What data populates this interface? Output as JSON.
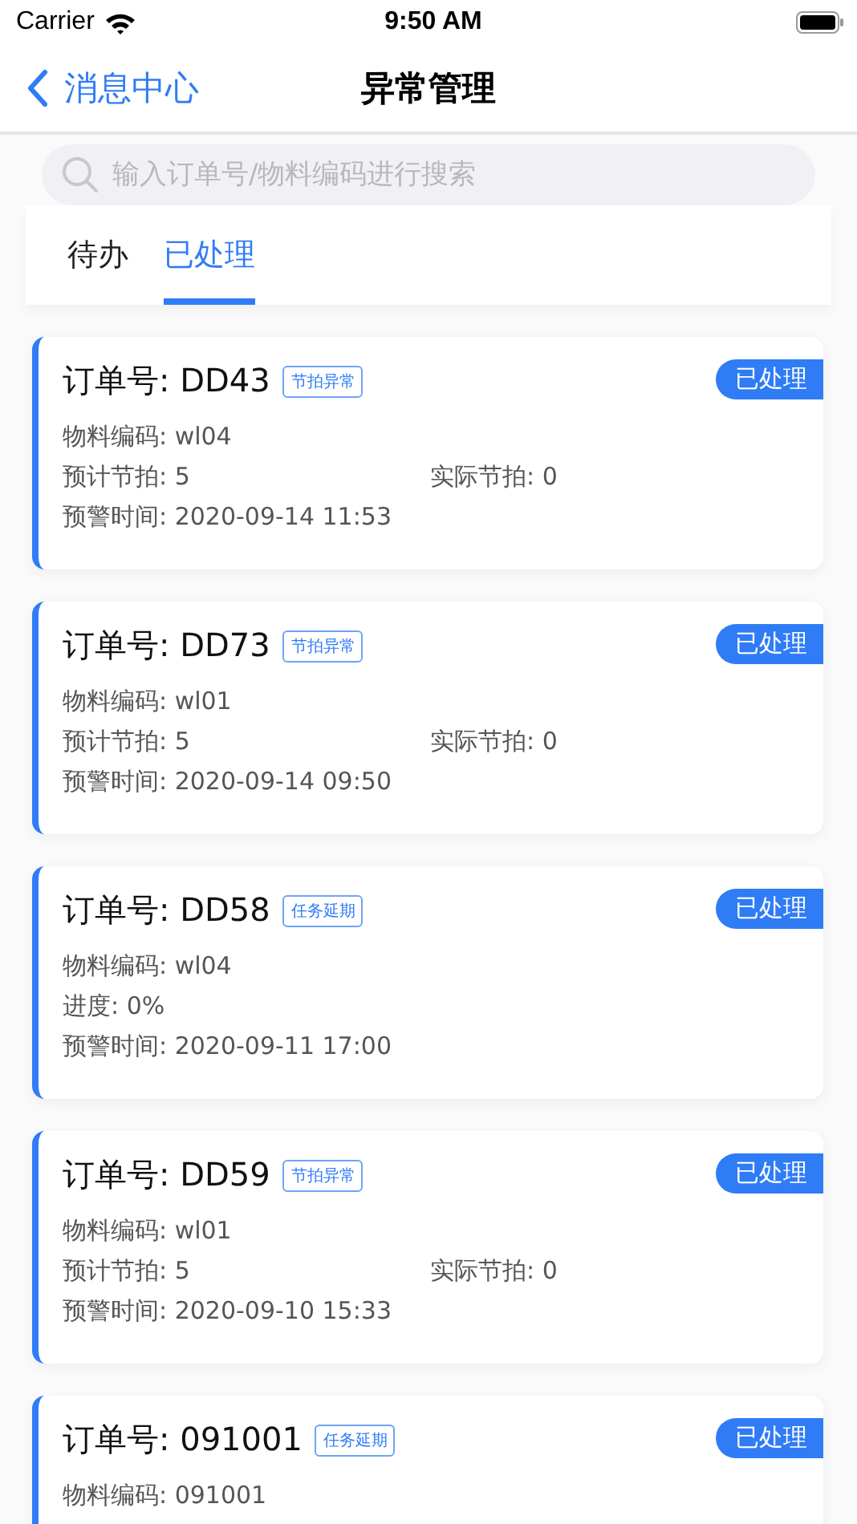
{
  "status_bar": {
    "carrier": "Carrier",
    "time": "9:50 AM"
  },
  "nav": {
    "back": "消息中心",
    "title": "异常管理"
  },
  "search": {
    "placeholder": "输入订单号/物料编码进行搜索"
  },
  "tabs": [
    {
      "label": "待办",
      "selected": false
    },
    {
      "label": "已处理",
      "selected": true
    }
  ],
  "cards": [
    {
      "order": "订单号: DD43",
      "tag": "节拍异常",
      "status": "已处理",
      "lines": [
        [
          "物料编码: wl04"
        ],
        [
          "预计节拍: 5",
          "实际节拍: 0"
        ],
        [
          "预警时间: 2020-09-14 11:53"
        ]
      ]
    },
    {
      "order": "订单号: DD73",
      "tag": "节拍异常",
      "status": "已处理",
      "lines": [
        [
          "物料编码: wl01"
        ],
        [
          "预计节拍: 5",
          "实际节拍: 0"
        ],
        [
          "预警时间: 2020-09-14 09:50"
        ]
      ]
    },
    {
      "order": "订单号: DD58",
      "tag": "任务延期",
      "status": "已处理",
      "lines": [
        [
          "物料编码: wl04"
        ],
        [
          "进度: 0%"
        ],
        [
          "预警时间: 2020-09-11 17:00"
        ]
      ]
    },
    {
      "order": "订单号: DD59",
      "tag": "节拍异常",
      "status": "已处理",
      "lines": [
        [
          "物料编码: wl01"
        ],
        [
          "预计节拍: 5",
          "实际节拍: 0"
        ],
        [
          "预警时间: 2020-09-10 15:33"
        ]
      ]
    },
    {
      "order": "订单号: 091001",
      "tag": "任务延期",
      "status": "已处理",
      "lines": [
        [
          "物料编码: 091001"
        ]
      ]
    }
  ]
}
